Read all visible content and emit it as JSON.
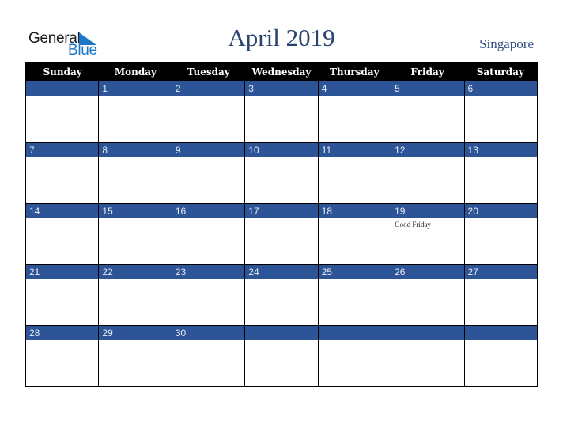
{
  "logo": {
    "text_general": "General",
    "text_blue": "Blue",
    "icon": "triangle-flag-icon",
    "brand_color": "#1e78c8"
  },
  "header": {
    "title": "April 2019",
    "country": "Singapore"
  },
  "colors": {
    "header_bg": "#000000",
    "date_band": "#2d5496",
    "title": "#2a4470"
  },
  "weekdays": [
    "Sunday",
    "Monday",
    "Tuesday",
    "Wednesday",
    "Thursday",
    "Friday",
    "Saturday"
  ],
  "weeks": [
    [
      {
        "day": "",
        "event": ""
      },
      {
        "day": "1",
        "event": ""
      },
      {
        "day": "2",
        "event": ""
      },
      {
        "day": "3",
        "event": ""
      },
      {
        "day": "4",
        "event": ""
      },
      {
        "day": "5",
        "event": ""
      },
      {
        "day": "6",
        "event": ""
      }
    ],
    [
      {
        "day": "7",
        "event": ""
      },
      {
        "day": "8",
        "event": ""
      },
      {
        "day": "9",
        "event": ""
      },
      {
        "day": "10",
        "event": ""
      },
      {
        "day": "11",
        "event": ""
      },
      {
        "day": "12",
        "event": ""
      },
      {
        "day": "13",
        "event": ""
      }
    ],
    [
      {
        "day": "14",
        "event": ""
      },
      {
        "day": "15",
        "event": ""
      },
      {
        "day": "16",
        "event": ""
      },
      {
        "day": "17",
        "event": ""
      },
      {
        "day": "18",
        "event": ""
      },
      {
        "day": "19",
        "event": "Good Friday"
      },
      {
        "day": "20",
        "event": ""
      }
    ],
    [
      {
        "day": "21",
        "event": ""
      },
      {
        "day": "22",
        "event": ""
      },
      {
        "day": "23",
        "event": ""
      },
      {
        "day": "24",
        "event": ""
      },
      {
        "day": "25",
        "event": ""
      },
      {
        "day": "26",
        "event": ""
      },
      {
        "day": "27",
        "event": ""
      }
    ],
    [
      {
        "day": "28",
        "event": ""
      },
      {
        "day": "29",
        "event": ""
      },
      {
        "day": "30",
        "event": ""
      },
      {
        "day": "",
        "event": ""
      },
      {
        "day": "",
        "event": ""
      },
      {
        "day": "",
        "event": ""
      },
      {
        "day": "",
        "event": ""
      }
    ]
  ]
}
